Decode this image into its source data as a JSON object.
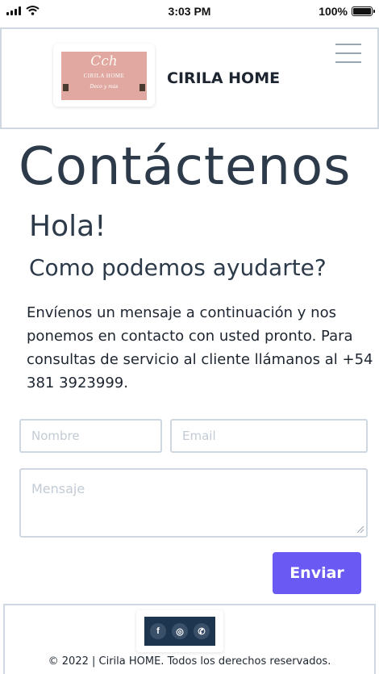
{
  "status_bar": {
    "time": "3:03 PM",
    "battery": "100%",
    "battery_level": 1.0
  },
  "header": {
    "logo": {
      "monogram": "Cch",
      "name": "CIRILA HOME",
      "tagline": "Deco y más"
    },
    "brand_name": "CIRILA HOME"
  },
  "contact": {
    "title": "Contáctenos",
    "greeting": "Hola!",
    "subtitle": "Como podemos ayudarte?",
    "intro": "Envíenos un mensaje a continuación y nos ponemos en contacto con usted pronto. Para consultas de servicio al cliente llámanos al +54 381 3923999."
  },
  "form": {
    "name_placeholder": "Nombre",
    "email_placeholder": "Email",
    "message_placeholder": "Mensaje",
    "submit_label": "Enviar"
  },
  "footer": {
    "social": [
      {
        "icon": "facebook-icon",
        "glyph": "f"
      },
      {
        "icon": "instagram-icon",
        "glyph": "◎"
      },
      {
        "icon": "whatsapp-icon",
        "glyph": "✆"
      }
    ],
    "copyright": "© 2022 | Cirila HOME. Todos los derechos reservados."
  },
  "colors": {
    "accent": "#6a59f2",
    "text": "#2d3a4a",
    "border": "#cfd8e0",
    "social_bg": "#1e3550",
    "logo_bg": "#e0a8a0"
  }
}
